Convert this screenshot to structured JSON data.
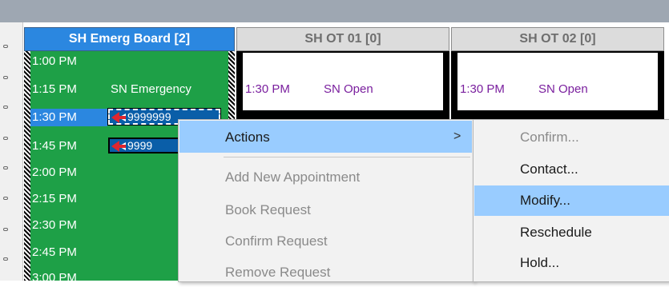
{
  "columns": [
    {
      "title": "SH Emerg Board [2]",
      "state": "active"
    },
    {
      "title": "SH OT 01 [0]",
      "state": "inactive"
    },
    {
      "title": "SH OT 02 [0]",
      "state": "inactive"
    }
  ],
  "emerg_board": {
    "times": [
      "1:00 PM",
      "1:15 PM",
      "1:30 PM",
      "1:45 PM",
      "2:00 PM",
      "2:15 PM",
      "2:30 PM",
      "2:45 PM",
      "3:00 PM"
    ],
    "slot_label_115": "SN Emergency",
    "appointments": [
      {
        "time": "1:30 PM",
        "id_text": "9999999"
      },
      {
        "time": "1:45 PM",
        "id_text": "9999"
      }
    ]
  },
  "ot01": {
    "time": "1:30 PM",
    "status": "SN Open"
  },
  "ot02": {
    "time": "1:30 PM",
    "status": "SN Open"
  },
  "context_menu": {
    "items": [
      {
        "label": "Actions",
        "enabled": true,
        "highlighted": true,
        "submenu": true
      },
      {
        "label": "Add New Appointment",
        "enabled": false
      },
      {
        "label": "Book Request",
        "enabled": false
      },
      {
        "label": "Confirm Request",
        "enabled": false
      },
      {
        "label": "Remove Request",
        "enabled": false
      }
    ],
    "submenu_arrow": ">"
  },
  "submenu": {
    "items": [
      {
        "label": "Confirm...",
        "enabled": false
      },
      {
        "label": "Contact...",
        "enabled": true
      },
      {
        "label": "Modify...",
        "enabled": true,
        "highlighted": true
      },
      {
        "label": "Reschedule",
        "enabled": true
      },
      {
        "label": "Hold...",
        "enabled": true
      }
    ]
  },
  "colors": {
    "accent": "#2b87e0",
    "board_green": "#1ea047",
    "appt_fill": "#0a5ea8",
    "ot_text": "#7a1f9e",
    "menu_highlight": "#99ccff"
  }
}
